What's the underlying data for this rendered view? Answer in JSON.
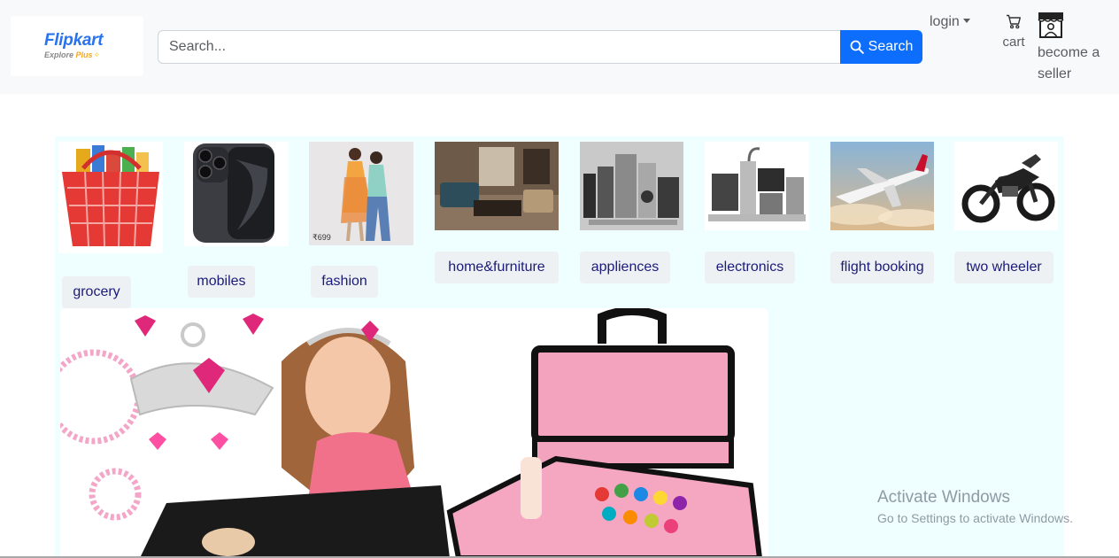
{
  "header": {
    "logo": {
      "brand": "Flipkart",
      "tagline_prefix": "Explore ",
      "tagline_plus": "Plus"
    },
    "search": {
      "placeholder": "Search...",
      "button_label": "Search"
    },
    "login_label": "login",
    "cart_label": "cart",
    "seller_label": "become a seller"
  },
  "categories": [
    {
      "label": "grocery",
      "icon": "grocery-basket-image"
    },
    {
      "label": "mobiles",
      "icon": "smartphone-image"
    },
    {
      "label": "fashion",
      "icon": "fashion-models-image",
      "price_tag": "₹699"
    },
    {
      "label": "home&furniture",
      "icon": "living-room-image"
    },
    {
      "label": "appliences",
      "icon": "appliances-image"
    },
    {
      "label": "electronics",
      "icon": "electronics-image"
    },
    {
      "label": "flight booking",
      "icon": "airplane-image"
    },
    {
      "label": "two wheeler",
      "icon": "motorcycle-image"
    }
  ],
  "banner": {
    "image": "kids-makeup-kit-banner"
  },
  "watermark": {
    "title": "Activate Windows",
    "subtitle": "Go to Settings to activate Windows."
  },
  "colors": {
    "brand": "#2874f0",
    "search_button": "#0d6efd",
    "header_bg": "#f8f9fa",
    "panel_bg": "#effefe",
    "category_text": "#1b1b7a"
  }
}
